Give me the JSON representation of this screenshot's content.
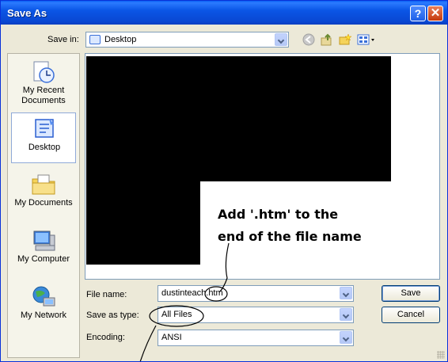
{
  "window": {
    "title": "Save As"
  },
  "toolbar": {
    "save_in_label": "Save in:",
    "save_in_value": "Desktop"
  },
  "places": [
    {
      "label": "My Recent Documents",
      "selected": false
    },
    {
      "label": "Desktop",
      "selected": true
    },
    {
      "label": "My Documents",
      "selected": false
    },
    {
      "label": "My Computer",
      "selected": false
    },
    {
      "label": "My Network",
      "selected": false
    }
  ],
  "annotation": {
    "line1": "Add '.htm' to the",
    "line2": "end of the file name"
  },
  "form": {
    "file_name_label": "File name:",
    "file_name_value": "dustinteach.htm",
    "save_as_type_label": "Save as type:",
    "save_as_type_value": "All Files",
    "encoding_label": "Encoding:",
    "encoding_value": "ANSI"
  },
  "buttons": {
    "save": "Save",
    "cancel": "Cancel"
  }
}
